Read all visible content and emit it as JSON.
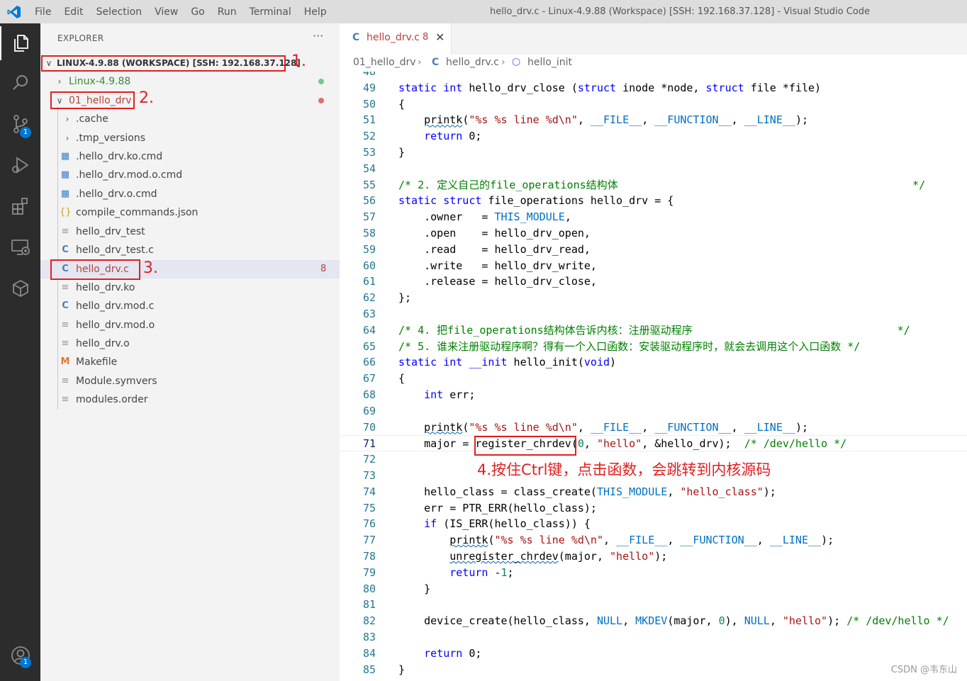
{
  "titlebar": {
    "menu": [
      "File",
      "Edit",
      "Selection",
      "View",
      "Go",
      "Run",
      "Terminal",
      "Help"
    ],
    "window_title": "hello_drv.c - Linux-4.9.88 (Workspace) [SSH: 192.168.37.128] - Visual Studio Code"
  },
  "activitybar": {
    "icons": [
      "explorer-icon",
      "search-icon",
      "source-control-icon",
      "run-debug-icon",
      "extensions-icon",
      "remote-explorer-icon",
      "cube-icon",
      "account-icon"
    ],
    "source_control_badge": "1",
    "account_badge": "1"
  },
  "sidebar": {
    "title": "EXPLORER",
    "more": "···",
    "workspace_label": "LINUX-4.9.88 (WORKSPACE) [SSH: 192.168.37.128]",
    "tree": [
      {
        "label": "Linux-4.9.88",
        "type": "folder",
        "expanded": false
      },
      {
        "label": "01_hello_drv",
        "type": "folder",
        "expanded": true
      },
      {
        "label": ".cache",
        "type": "folder",
        "expanded": false
      },
      {
        "label": ".tmp_versions",
        "type": "folder",
        "expanded": false
      },
      {
        "label": ".hello_drv.ko.cmd",
        "type": "windows"
      },
      {
        "label": ".hello_drv.mod.o.cmd",
        "type": "windows"
      },
      {
        "label": ".hello_drv.o.cmd",
        "type": "windows"
      },
      {
        "label": "compile_commands.json",
        "type": "json"
      },
      {
        "label": "hello_drv_test",
        "type": "text"
      },
      {
        "label": "hello_drv_test.c",
        "type": "c"
      },
      {
        "label": "hello_drv.c",
        "type": "c",
        "problems": "8"
      },
      {
        "label": "hello_drv.ko",
        "type": "text"
      },
      {
        "label": "hello_drv.mod.c",
        "type": "c"
      },
      {
        "label": "hello_drv.mod.o",
        "type": "text"
      },
      {
        "label": "hello_drv.o",
        "type": "text"
      },
      {
        "label": "Makefile",
        "type": "makefile"
      },
      {
        "label": "Module.symvers",
        "type": "text"
      },
      {
        "label": "modules.order",
        "type": "text"
      }
    ],
    "colors": {
      "git_added": "#73c991",
      "error": "#e06c75",
      "green_text": "#388a34",
      "red_text": "#b5433c"
    }
  },
  "annotations": {
    "a1": "1.",
    "a2": "2.",
    "a3": "3.",
    "a4": "4.按住Ctrl键，点击函数，会跳转到内核源码"
  },
  "editor": {
    "tab": {
      "icon": "C",
      "name": "hello_drv.c",
      "count": "8",
      "close": "✕"
    },
    "breadcrumb": {
      "folder": "01_hello_drv",
      "file_icon": "C",
      "file": "hello_drv.c",
      "symbol": "hello_init"
    },
    "watermark": "CSDN @韦东山"
  },
  "code": [
    {
      "n": "48",
      "t": ""
    },
    {
      "n": "49",
      "t": "static int hello_drv_close (struct inode *node, struct file *file)"
    },
    {
      "n": "50",
      "t": "{"
    },
    {
      "n": "51",
      "t": "    printk(\"%s %s line %d\\n\", __FILE__, __FUNCTION__, __LINE__);"
    },
    {
      "n": "52",
      "t": "    return 0;"
    },
    {
      "n": "53",
      "t": "}"
    },
    {
      "n": "54",
      "t": ""
    },
    {
      "n": "55",
      "t": "/* 2. 定义自己的file_operations结构体                                              */"
    },
    {
      "n": "56",
      "t": "static struct file_operations hello_drv = {"
    },
    {
      "n": "57",
      "t": "    .owner   = THIS_MODULE,"
    },
    {
      "n": "58",
      "t": "    .open    = hello_drv_open,"
    },
    {
      "n": "59",
      "t": "    .read    = hello_drv_read,"
    },
    {
      "n": "60",
      "t": "    .write   = hello_drv_write,"
    },
    {
      "n": "61",
      "t": "    .release = hello_drv_close,"
    },
    {
      "n": "62",
      "t": "};"
    },
    {
      "n": "63",
      "t": ""
    },
    {
      "n": "64",
      "t": "/* 4. 把file_operations结构体告诉内核：注册驱动程序                                */"
    },
    {
      "n": "65",
      "t": "/* 5. 谁来注册驱动程序啊？得有一个入口函数：安装驱动程序时，就会去调用这个入口函数 */"
    },
    {
      "n": "66",
      "t": "static int __init hello_init(void)"
    },
    {
      "n": "67",
      "t": "{"
    },
    {
      "n": "68",
      "t": "    int err;"
    },
    {
      "n": "69",
      "t": ""
    },
    {
      "n": "70",
      "t": "    printk(\"%s %s line %d\\n\", __FILE__, __FUNCTION__, __LINE__);"
    },
    {
      "n": "71",
      "t": "    major = register_chrdev(0, \"hello\", &hello_drv);  /* /dev/hello */"
    },
    {
      "n": "72",
      "t": ""
    },
    {
      "n": "73",
      "t": ""
    },
    {
      "n": "74",
      "t": "    hello_class = class_create(THIS_MODULE, \"hello_class\");"
    },
    {
      "n": "75",
      "t": "    err = PTR_ERR(hello_class);"
    },
    {
      "n": "76",
      "t": "    if (IS_ERR(hello_class)) {"
    },
    {
      "n": "77",
      "t": "        printk(\"%s %s line %d\\n\", __FILE__, __FUNCTION__, __LINE__);"
    },
    {
      "n": "78",
      "t": "        unregister_chrdev(major, \"hello\");"
    },
    {
      "n": "79",
      "t": "        return -1;"
    },
    {
      "n": "80",
      "t": "    }"
    },
    {
      "n": "81",
      "t": ""
    },
    {
      "n": "82",
      "t": "    device_create(hello_class, NULL, MKDEV(major, 0), NULL, \"hello\"); /* /dev/hello */"
    },
    {
      "n": "83",
      "t": ""
    },
    {
      "n": "84",
      "t": "    return 0;"
    },
    {
      "n": "85",
      "t": "}"
    }
  ]
}
